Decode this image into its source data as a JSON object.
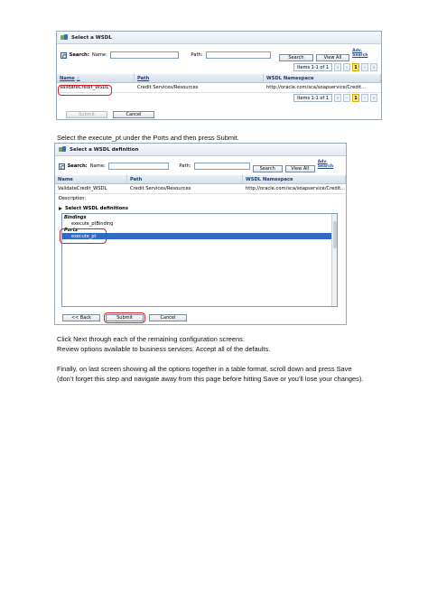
{
  "screenshot1": {
    "title": "Select a WSDL",
    "search_label": "Search:",
    "name_label": "Name:",
    "path_label": "Path:",
    "search_button": "Search",
    "view_all_button": "View All",
    "adv_search": "Adv. Search",
    "pager_items": "Items 1-1 of 1",
    "pager_page": "1",
    "columns": [
      "Name",
      "Path",
      "WSDL Namespace"
    ],
    "rows": [
      [
        "ValidateCredit_WSDL",
        "Credit Services/Resources",
        "http://oracle.com/sca/soapservice/Credit..."
      ]
    ],
    "submit_button": "Submit",
    "cancel_button": "Cancel"
  },
  "instruction1": "Select the execute_pt under the Ports and then press Submit.",
  "screenshot2": {
    "title": "Select a WSDL definition",
    "search_label": "Search:",
    "name_label": "Name:",
    "path_label": "Path:",
    "search_button": "Search",
    "view_all_button": "View All",
    "adv_search": "Adv. Search",
    "columns": [
      "Name",
      "Path",
      "WSDL Namespace"
    ],
    "rows": [
      [
        "ValidateCredit_WSDL",
        "Credit Services/Resources",
        "http://oracle.com/sca/soapservice/Credit..."
      ]
    ],
    "description_label": "Description:",
    "section_title": "Select WSDL definitions",
    "group_bindings": "Bindings",
    "binding_item": "execute_ptBinding",
    "group_ports": "Ports",
    "port_item": "execute_pt",
    "back_button": "<< Back",
    "submit_button": "Submit",
    "cancel_button": "Cancel"
  },
  "paragraph1": [
    "Click Next through each of the remaining configuration screens.",
    "Review options available to business services. Accept all of the defaults."
  ],
  "paragraph2": [
    "Finally, on last screen showing all the options together in a table format, scroll down and press Save",
    "(don’t forget this step and navigate away from this page before hitting Save or you’ll lose your changes)."
  ],
  "colors": {
    "highlight_ring": "#d3202a",
    "selection": "#316ac5",
    "current_page": "#ffe88a"
  }
}
